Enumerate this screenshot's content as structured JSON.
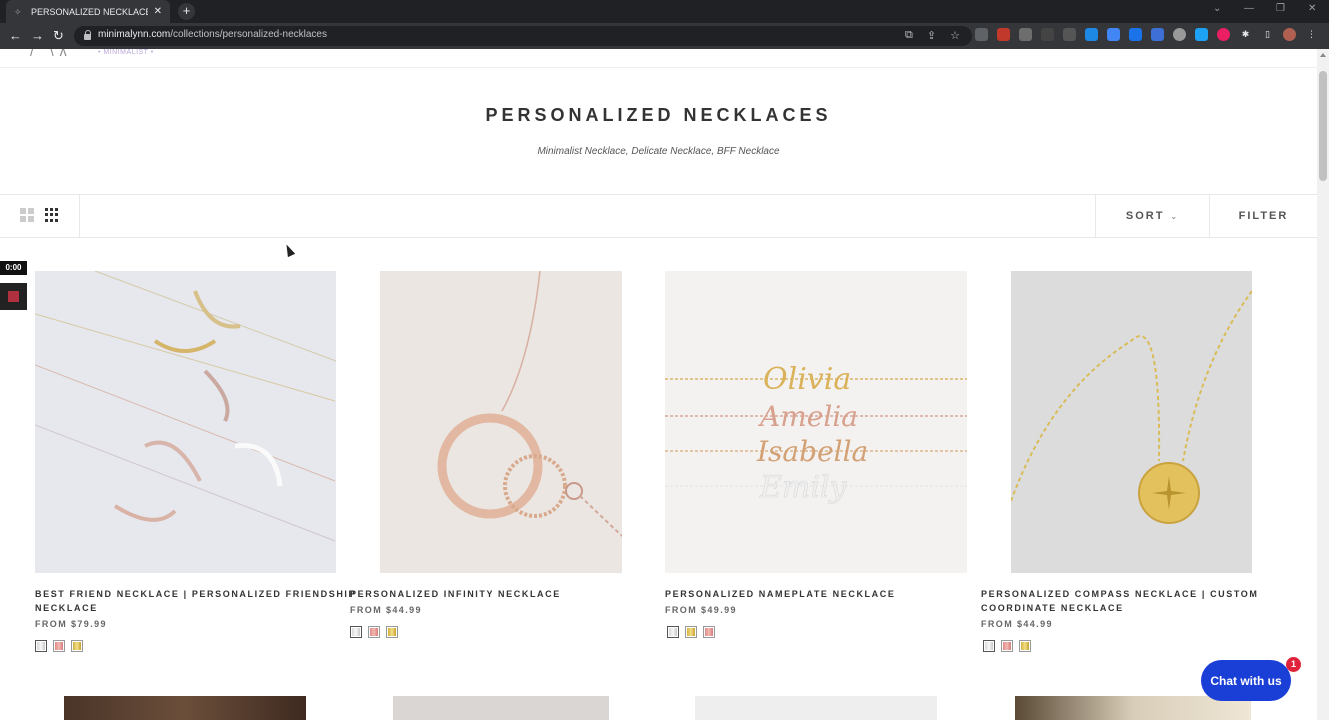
{
  "browser": {
    "tab_title": "PERSONALIZED NECKLACES – ly",
    "url_host": "minimalynn.com",
    "url_path": "/collections/personalized-necklaces"
  },
  "header": {
    "logo_sub": "• MINIMALIST •"
  },
  "collection": {
    "title": "PERSONALIZED NECKLACES",
    "subtitle": "Minimalist Necklace, Delicate Necklace, BFF Necklace"
  },
  "toolbar": {
    "sort_label": "SORT",
    "filter_label": "FILTER"
  },
  "recorder": {
    "time": "0:00"
  },
  "products": [
    {
      "name_line1": "BEST FRIEND NECKLACE | PERSONALIZED FRIENDSHIP",
      "name_line2": "NECKLACE",
      "price": "FROM $79.99",
      "swatches": [
        "#e8e8e8",
        "#e8a0a0",
        "#e6c85a"
      ]
    },
    {
      "name_line1": "PERSONALIZED INFINITY NECKLACE",
      "name_line2": "",
      "price": "FROM $44.99",
      "swatches": [
        "#e8e8e8",
        "#e8a0a0",
        "#e6c85a"
      ]
    },
    {
      "name_line1": "PERSONALIZED NAMEPLATE NECKLACE",
      "name_line2": "",
      "price": "FROM $49.99",
      "swatches": [
        "#e8e8e8",
        "#e6c85a",
        "#e8a0a0"
      ]
    },
    {
      "name_line1": "PERSONALIZED COMPASS NECKLACE | CUSTOM",
      "name_line2": "COORDINATE NECKLACE",
      "price": "FROM $44.99",
      "swatches": [
        "#e8e8e8",
        "#e8a0a0",
        "#e6c85a"
      ]
    }
  ],
  "product_images": [
    {
      "text": ""
    },
    {
      "text": ""
    },
    {
      "names": [
        "Olivia",
        "Amelia",
        "Isabella",
        "Emily"
      ]
    },
    {
      "text": ""
    }
  ],
  "chat": {
    "label": "Chat with us",
    "badge": "1"
  },
  "colors": {
    "chat_button": "#1a3fd6",
    "badge": "#e0233a"
  }
}
